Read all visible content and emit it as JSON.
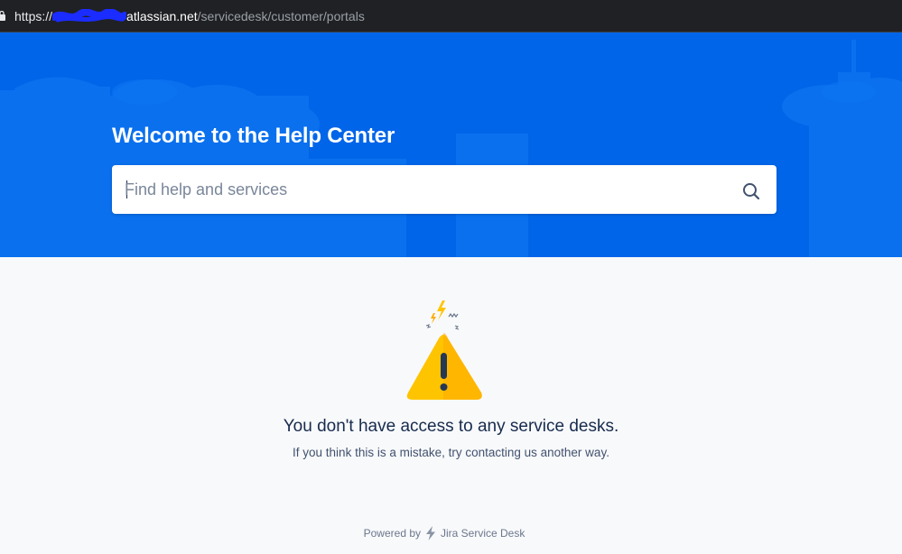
{
  "browser": {
    "url_scheme": "https://",
    "url_host": "atlassian.net",
    "url_path": "/servicedesk/customer/portals"
  },
  "header": {
    "title": "Welcome to the Help Center",
    "search_placeholder": "Find help and services",
    "search_icon": "search-icon"
  },
  "main": {
    "icon": "warning-triangle-icon",
    "title": "You don't have access to any service desks.",
    "subtitle": "If you think this is a mistake, try contacting us another way."
  },
  "footer": {
    "powered_by": "Powered by",
    "product": "Jira Service Desk",
    "logo_icon": "jira-bolt-icon"
  },
  "colors": {
    "header_blue": "#0065e8",
    "warning_yellow": "#ffc400",
    "text_dark": "#172b4d"
  }
}
